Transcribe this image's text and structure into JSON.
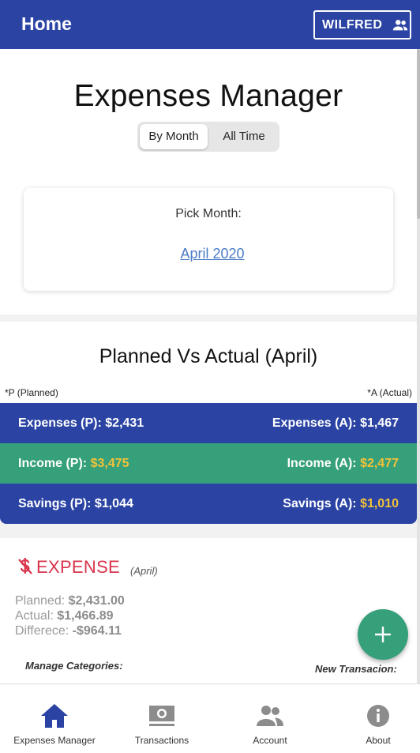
{
  "header": {
    "title": "Home",
    "user_name": "WILFRED",
    "user_icon": "people-icon"
  },
  "main": {
    "title": "Expenses Manager",
    "tabs": [
      {
        "label": "By Month",
        "selected": true
      },
      {
        "label": "All Time",
        "selected": false
      }
    ],
    "pick_month": {
      "label": "Pick Month:",
      "value": "April 2020"
    }
  },
  "planned_vs_actual": {
    "title": "Planned Vs Actual (April)",
    "legend_planned": "*P (Planned)",
    "legend_actual": "*A (Actual)",
    "rows": [
      {
        "planned_label": "Expenses (P):",
        "planned_value": "$2,431",
        "actual_label": "Expenses (A):",
        "actual_value": "$1,467"
      },
      {
        "planned_label": "Income (P):",
        "planned_value": "$3,475",
        "actual_label": "Income (A):",
        "actual_value": "$2,477"
      },
      {
        "planned_label": "Savings (P):",
        "planned_value": "$1,044",
        "actual_label": "Savings (A):",
        "actual_value": "$1,010"
      }
    ],
    "colors": {
      "expenses": "#2b44a4",
      "income": "#36a07a",
      "highlight": "#f2c23a"
    }
  },
  "expense_section": {
    "icon": "dollar-icon",
    "title": "EXPENSE",
    "month": "(April)",
    "planned_label": "Planned:",
    "planned_value": "$2,431.00",
    "actual_label": "Actual:",
    "actual_value": "$1,466.89",
    "difference_label": "Differece:",
    "difference_value": "-$964.11",
    "manage_categories": "Manage Categories:",
    "new_transaction": "New Transacion:",
    "accent_color": "#d9344b"
  },
  "fab": {
    "icon": "plus-icon"
  },
  "bottom_nav": [
    {
      "label": "Expenses Manager",
      "icon": "home-icon",
      "active": true
    },
    {
      "label": "Transactions",
      "icon": "money-icon",
      "active": false
    },
    {
      "label": "Account",
      "icon": "people-icon",
      "active": false
    },
    {
      "label": "About",
      "icon": "info-icon",
      "active": false
    }
  ]
}
